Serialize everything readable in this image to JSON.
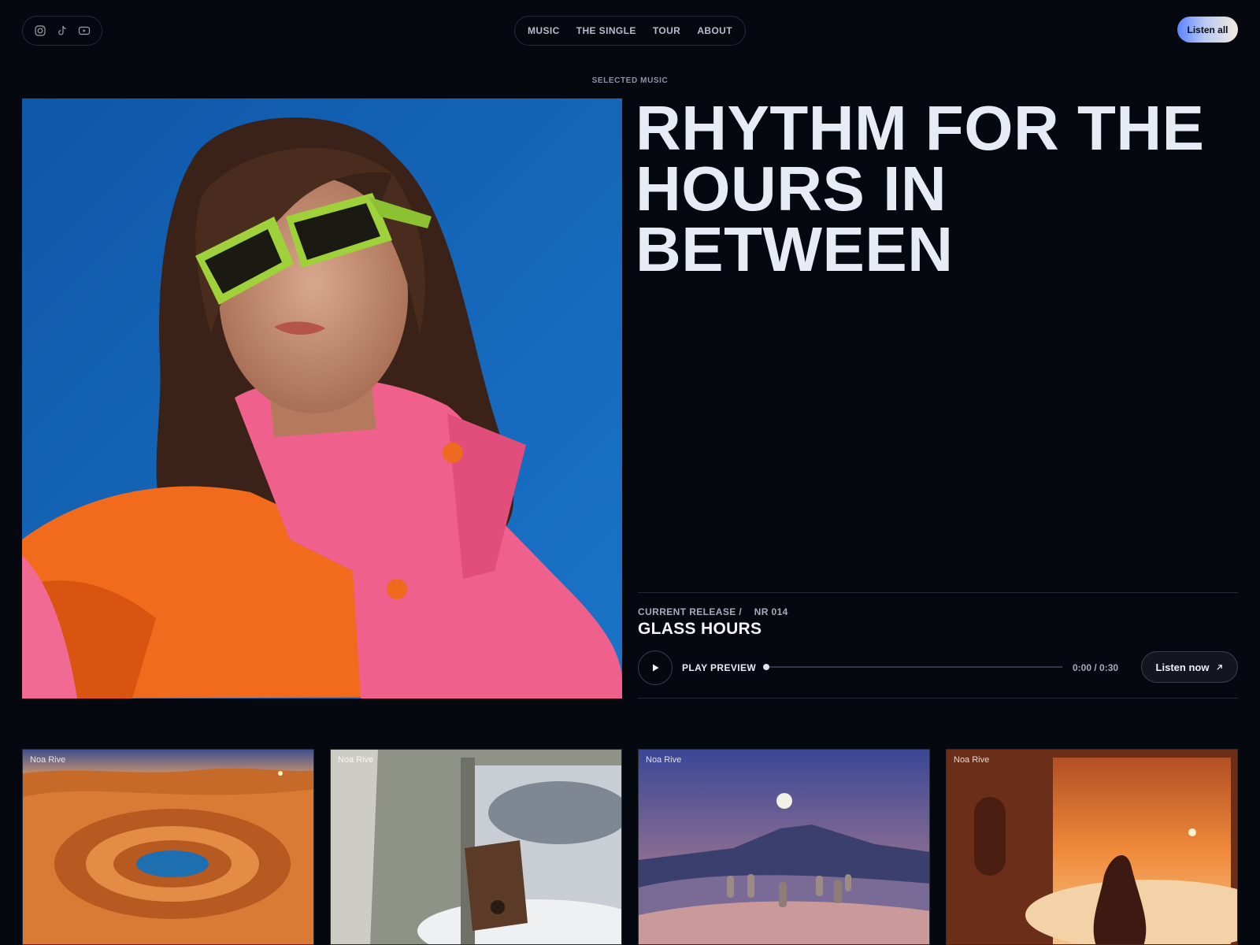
{
  "header": {
    "socials": [
      {
        "icon": "instagram-icon"
      },
      {
        "icon": "tiktok-icon"
      },
      {
        "icon": "youtube-icon"
      }
    ],
    "nav": [
      "MUSIC",
      "THE SINGLE",
      "TOUR",
      "ABOUT"
    ],
    "cta_label": "Listen all"
  },
  "hero": {
    "eyebrow": "SELECTED MUSIC",
    "headline": "RHYTHM FOR THE HOURS IN BETWEEN"
  },
  "release": {
    "label": "CURRENT RELEASE /",
    "number": "NR 014",
    "title": "GLASS HOURS",
    "play_label": "PLAY PREVIEW",
    "time": "0:00 / 0:30",
    "progress": 0,
    "listen_label": "Listen now"
  },
  "albums": [
    {
      "artist": "Noa Rive"
    },
    {
      "artist": "Noa Rive"
    },
    {
      "artist": "Noa Rive"
    },
    {
      "artist": "Noa Rive"
    }
  ],
  "colors": {
    "background": "#06080f",
    "sky_blue": "#1563b8",
    "coat_pink": "#f0608c",
    "coat_orange": "#f26a1c",
    "sunglasses_green": "#9ed13a",
    "accent_gradient_start": "#5a84ff"
  }
}
